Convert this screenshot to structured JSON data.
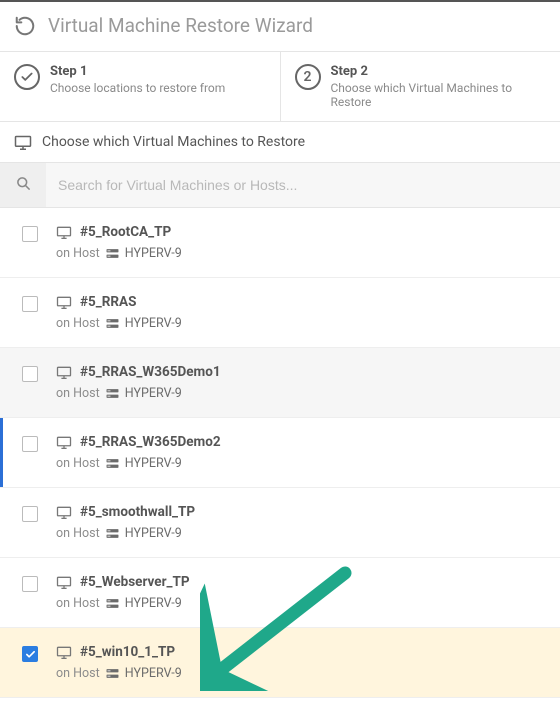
{
  "header": {
    "title": "Virtual Machine Restore Wizard"
  },
  "steps": [
    {
      "num": "✓",
      "title": "Step 1",
      "desc": "Choose locations to restore from",
      "done": true
    },
    {
      "num": "2",
      "title": "Step 2",
      "desc": "Choose which Virtual Machines to Restore",
      "done": false
    }
  ],
  "section": {
    "title": "Choose which Virtual Machines to Restore"
  },
  "search": {
    "placeholder": "Search for Virtual Machines or Hosts...",
    "value": ""
  },
  "host_label_prefix": "on Host",
  "vms": [
    {
      "name": "#5_RootCA_TP",
      "host": "HYPERV-9",
      "checked": false,
      "hover": false,
      "leftaccent": false
    },
    {
      "name": "#5_RRAS",
      "host": "HYPERV-9",
      "checked": false,
      "hover": false,
      "leftaccent": false
    },
    {
      "name": "#5_RRAS_W365Demo1",
      "host": "HYPERV-9",
      "checked": false,
      "hover": true,
      "leftaccent": false
    },
    {
      "name": "#5_RRAS_W365Demo2",
      "host": "HYPERV-9",
      "checked": false,
      "hover": false,
      "leftaccent": true
    },
    {
      "name": "#5_smoothwall_TP",
      "host": "HYPERV-9",
      "checked": false,
      "hover": false,
      "leftaccent": false
    },
    {
      "name": "#5_Webserver_TP",
      "host": "HYPERV-9",
      "checked": false,
      "hover": false,
      "leftaccent": false
    },
    {
      "name": "#5_win10_1_TP",
      "host": "HYPERV-9",
      "checked": true,
      "hover": false,
      "leftaccent": false
    }
  ],
  "colors": {
    "accent": "#2b7de1",
    "arrow": "#1fa88a",
    "selectedbg": "#fff5dd"
  }
}
